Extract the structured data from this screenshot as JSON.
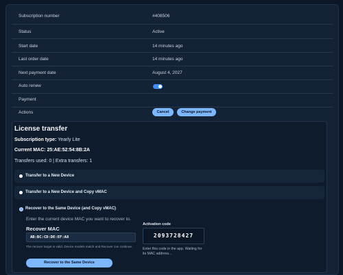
{
  "details": [
    {
      "label": "Subscription number",
      "value": "#408506"
    },
    {
      "label": "Status",
      "value": "Active"
    },
    {
      "label": "Start date",
      "value": "14 minutes ago"
    },
    {
      "label": "Last order date",
      "value": "14 minutes ago"
    },
    {
      "label": "Next payment date",
      "value": "August 4, 2027"
    },
    {
      "label": "Auto renew",
      "value": ""
    },
    {
      "label": "Payment",
      "value": ""
    },
    {
      "label": "Actions",
      "value": ""
    }
  ],
  "auto_renew": {
    "enabled": true
  },
  "actions": {
    "cancel_label": "Cancel",
    "change_payment_label": "Change payment"
  },
  "license_transfer": {
    "title": "License transfer",
    "subscription_type_label": "Subscription type:",
    "subscription_type_value": "Yearly Lite",
    "current_mac_label": "Current MAC:",
    "current_mac_value": "25:AE:52:54:8B:2A",
    "transfers_text": "Transfers used: 0 | Extra transfers: 1",
    "options": [
      {
        "label": "Transfer to a New Device",
        "selected": false
      },
      {
        "label": "Transfer to a New Device and Copy vMAC",
        "selected": false
      },
      {
        "label": "Recover to the Same Device (and Copy vMAC)",
        "selected": true
      }
    ],
    "recover": {
      "instruction": "Enter the current device MAC you want to recover to.",
      "recover_mac_label": "Recover MAC",
      "mac_value": "AB:BC:CD:DE:EF:A8",
      "mac_help": "The recover target is valid. Device models match and Recover can continue.",
      "activation_code_label": "Activation code",
      "activation_code": "2093728427",
      "activation_help": "Enter this code in the app. Waiting for its MAC address...",
      "button_label": "Recover to the Same Device"
    }
  },
  "colors": {
    "accent": "#7cb7ff",
    "toggle": "#3f8cff",
    "background": "#0b1626",
    "panel": "#142236"
  }
}
